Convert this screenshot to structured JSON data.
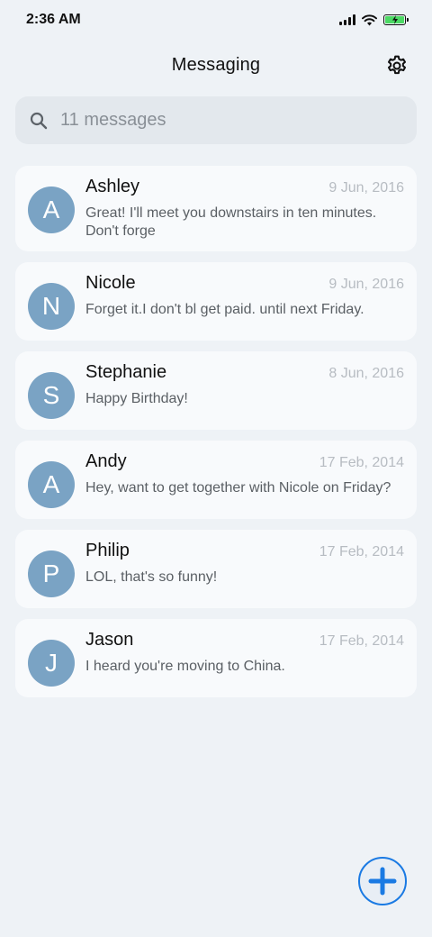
{
  "status_bar": {
    "time": "2:36 AM"
  },
  "header": {
    "title": "Messaging"
  },
  "search": {
    "placeholder": "11 messages"
  },
  "conversations": [
    {
      "initial": "A",
      "name": "Ashley",
      "date": "9 Jun, 2016",
      "preview": "Great! I'll meet you downstairs in ten minutes. Don't forge"
    },
    {
      "initial": "N",
      "name": "Nicole",
      "date": "9 Jun, 2016",
      "preview": "Forget it.I don't bl get paid. until next Friday."
    },
    {
      "initial": "S",
      "name": "Stephanie",
      "date": "8 Jun, 2016",
      "preview": "Happy Birthday!"
    },
    {
      "initial": "A",
      "name": "Andy",
      "date": "17 Feb, 2014",
      "preview": "Hey, want to get together with Nicole on Friday?"
    },
    {
      "initial": "P",
      "name": "Philip",
      "date": "17 Feb, 2014",
      "preview": "LOL, that's so funny!"
    },
    {
      "initial": "J",
      "name": "Jason",
      "date": "17 Feb, 2014",
      "preview": "I heard you're moving to China."
    }
  ],
  "icons": {
    "settings": "gear-icon",
    "search": "search-icon",
    "compose": "plus-icon"
  },
  "colors": {
    "background": "#eef2f6",
    "avatar": "#7aa3c4",
    "accent": "#1a7ae3",
    "battery": "#4cd964"
  }
}
